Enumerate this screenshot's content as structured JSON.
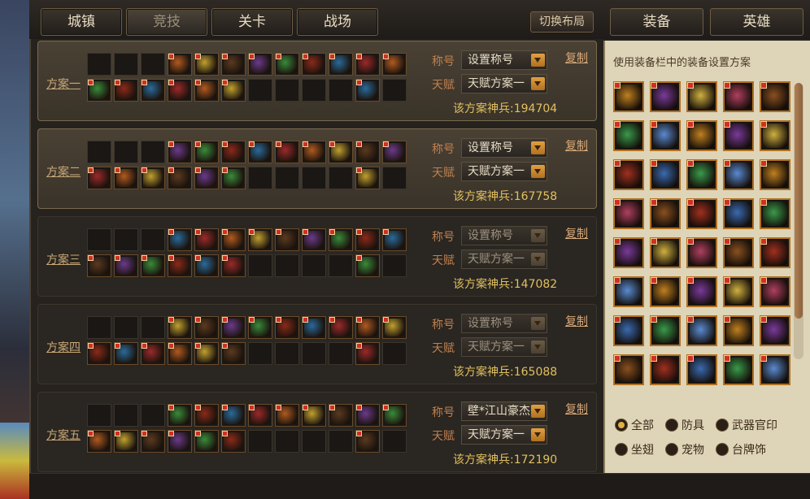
{
  "nav": {
    "tabs": [
      "城镇",
      "竞技",
      "关卡",
      "战场"
    ],
    "active_tab": "竞技",
    "switch_layout_label": "切换布局",
    "right_tabs": [
      "装备",
      "英雄"
    ]
  },
  "plans": [
    {
      "name": "方案一",
      "title_label": "称号",
      "title_value": "设置称号",
      "talent_label": "天赋",
      "talent_value": "天赋方案一",
      "copy_label": "复制",
      "power_text": "该方案神兵:194704"
    },
    {
      "name": "方案二",
      "title_label": "称号",
      "title_value": "设置称号",
      "talent_label": "天赋",
      "talent_value": "天赋方案一",
      "copy_label": "复制",
      "power_text": "该方案神兵:167758"
    },
    {
      "name": "方案三",
      "title_label": "称号",
      "title_value": "设置称号",
      "talent_label": "天赋",
      "talent_value": "天赋方案一",
      "copy_label": "复制",
      "power_text": "该方案神兵:147082"
    },
    {
      "name": "方案四",
      "title_label": "称号",
      "title_value": "设置称号",
      "talent_label": "天赋",
      "talent_value": "天赋方案一",
      "copy_label": "复制",
      "power_text": "该方案神兵:165088"
    },
    {
      "name": "方案五",
      "title_label": "称号",
      "title_value": "壁*江山豪杰",
      "talent_label": "天赋",
      "talent_value": "天赋方案一",
      "copy_label": "复制",
      "power_text": "该方案神兵:172190"
    }
  ],
  "equipment_panel": {
    "hint": "使用装备栏中的装备设置方案",
    "filters": [
      "全部",
      "防具",
      "武器官印",
      "坐翅",
      "宠物",
      "台牌饰"
    ],
    "selected_filter": "全部"
  },
  "colors": {
    "accent": "#e0a040",
    "gold_text": "#e0c060",
    "link": "#d8a878"
  },
  "icons": {
    "slot_icons": [
      "equipment-slot-icon",
      "lock-icon",
      "dropdown-arrow-icon"
    ]
  }
}
